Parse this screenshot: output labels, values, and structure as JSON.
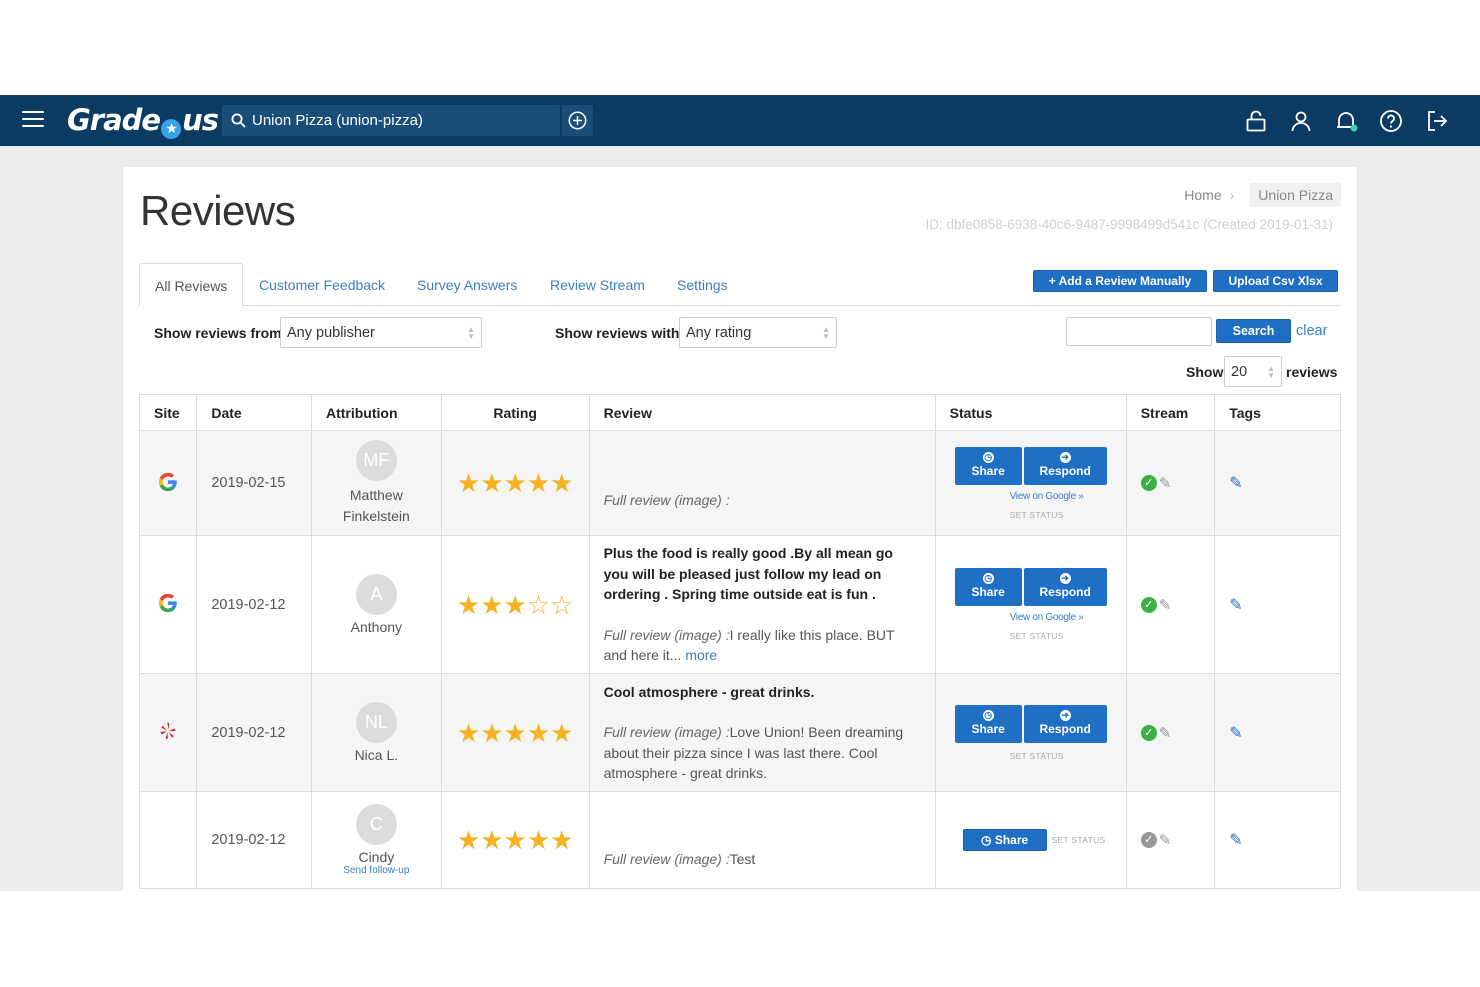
{
  "header": {
    "logo": {
      "left": "Grade",
      "right": "us"
    },
    "location_search": "Union Pizza (union-pizza)",
    "icons": [
      "lock-icon",
      "user-icon",
      "notification-bell-icon",
      "help-icon",
      "logout-icon"
    ],
    "colors": {
      "bar": "#0b3a63",
      "accent": "#1f6fc5"
    }
  },
  "page": {
    "title": "Reviews",
    "breadcrumb": {
      "home": "Home",
      "current": "Union Pizza"
    },
    "id_line": "ID: dbfe0858-6938-40c6-9487-9998499d541c (Created 2019-01-31)"
  },
  "tabs": [
    "All Reviews",
    "Customer Feedback",
    "Survey Answers",
    "Review Stream",
    "Settings"
  ],
  "actions": {
    "add_manual": "+ Add a Review Manually",
    "upload_csv": "Upload Csv Xlsx"
  },
  "filters": {
    "publisher_label": "Show reviews from",
    "publisher_value": "Any publisher",
    "rating_label": "Show reviews with",
    "rating_value": "Any rating",
    "search_value": "",
    "search_button": "Search",
    "clear_link": "clear",
    "show_label": "Show",
    "show_value": "20",
    "show_suffix": "reviews"
  },
  "table": {
    "columns": [
      "Site",
      "Date",
      "Attribution",
      "Rating",
      "Review",
      "Status",
      "Stream",
      "Tags"
    ],
    "labels": {
      "share": "Share",
      "respond": "Respond",
      "view_on_google": "View on Google »",
      "set_status": "SET STATUS",
      "full_review": "Full review",
      "image": "(image)",
      "more": "more",
      "send_followup": "Send follow-up"
    },
    "rows": [
      {
        "site": "google",
        "date": "2019-02-15",
        "initials": "MF",
        "name": "Matthew Finkelstein",
        "rating": 5,
        "headline": "",
        "body": ""
      },
      {
        "site": "google",
        "date": "2019-02-12",
        "initials": "A",
        "name": "Anthony",
        "rating": 3,
        "headline": "Plus the food is really good .By all mean go you will be pleased just follow my lead on ordering . Spring time outside eat is fun .",
        "body": "I really like this place. BUT and here it..."
      },
      {
        "site": "yelp",
        "date": "2019-02-12",
        "initials": "NL",
        "name": "Nica L.",
        "rating": 5,
        "headline": "Cool atmosphere - great drinks.",
        "body": "Love Union! Been dreaming about their pizza since I was last there. Cool atmosphere - great drinks."
      },
      {
        "site": "none",
        "date": "2019-02-12",
        "initials": "C",
        "name": "Cindy",
        "rating": 5,
        "headline": "",
        "body": "Test"
      }
    ]
  }
}
